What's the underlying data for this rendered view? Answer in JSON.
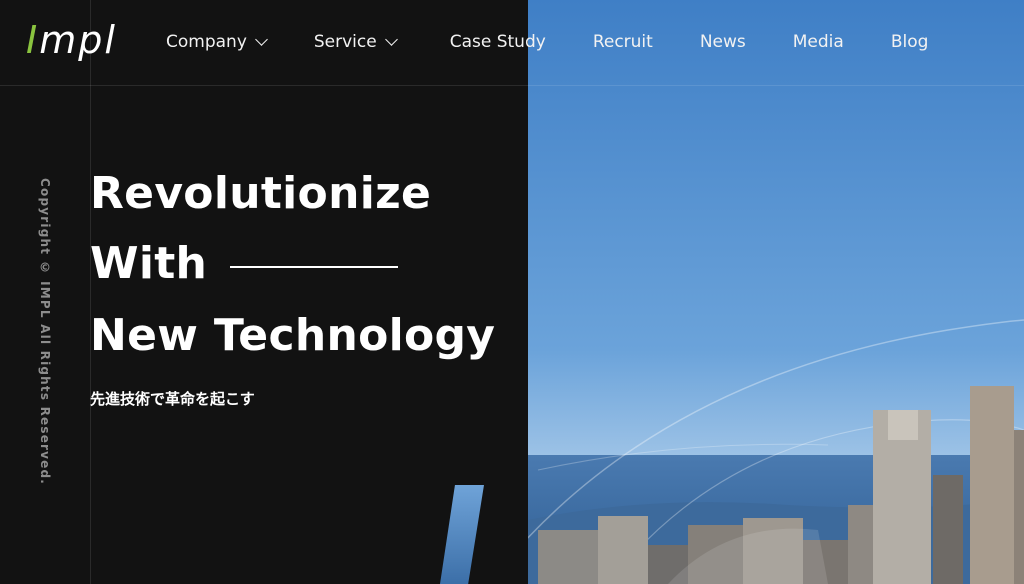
{
  "brand": {
    "logo_prefix": "I",
    "logo_rest": "mpl",
    "accent_color": "#8ac43f"
  },
  "nav": {
    "items": [
      {
        "label": "Company",
        "has_dropdown": true
      },
      {
        "label": "Service",
        "has_dropdown": true
      },
      {
        "label": "Case Study",
        "has_dropdown": false
      },
      {
        "label": "Recruit",
        "has_dropdown": false
      },
      {
        "label": "News",
        "has_dropdown": false
      },
      {
        "label": "Media",
        "has_dropdown": false
      },
      {
        "label": "Blog",
        "has_dropdown": false
      }
    ]
  },
  "hero": {
    "line1": "Revolutionize",
    "line2": "With",
    "line3": "New Technology",
    "subtitle": "先進技術で革命を起こす"
  },
  "footer": {
    "copyright": "Copyright © IMPL All Rights Reserved."
  },
  "colors": {
    "background": "#121212",
    "sky": "#4e8fcf",
    "text": "#ffffff"
  }
}
